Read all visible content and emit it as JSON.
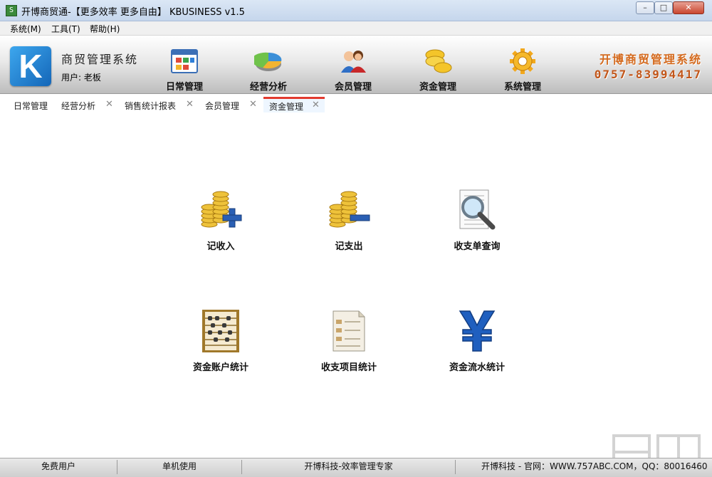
{
  "window": {
    "title": "开博商贸通-【更多效率 更多自由】 KBUSINESS v1.5",
    "app_icon_glyph": "S",
    "minimize": "–",
    "maximize": "□",
    "close": "✕"
  },
  "menu": [
    {
      "label": "系统(M)"
    },
    {
      "label": "工具(T)"
    },
    {
      "label": "帮助(H)"
    }
  ],
  "header": {
    "logo_letter": "K",
    "system_name": "商贸管理系统",
    "user_label": "用户: 老板",
    "nav": [
      {
        "label": "日常管理",
        "icon": "calendar-window-icon"
      },
      {
        "label": "经营分析",
        "icon": "pie-chart-icon"
      },
      {
        "label": "会员管理",
        "icon": "users-icon"
      },
      {
        "label": "资金管理",
        "icon": "coins-icon"
      },
      {
        "label": "系统管理",
        "icon": "gear-icon"
      }
    ],
    "brand_name": "开博商贸管理系统",
    "brand_phone": "0757-83994417"
  },
  "tabs": [
    {
      "label": "日常管理",
      "closable": false,
      "active": false
    },
    {
      "label": "经营分析",
      "closable": true,
      "active": false
    },
    {
      "label": "销售统计报表",
      "closable": true,
      "active": false
    },
    {
      "label": "会员管理",
      "closable": true,
      "active": false
    },
    {
      "label": "资金管理",
      "closable": true,
      "active": true
    }
  ],
  "tab_close_glyph": "✕",
  "functions": [
    {
      "label": "记收入",
      "icon": "coins-plus-icon"
    },
    {
      "label": "记支出",
      "icon": "coins-minus-icon"
    },
    {
      "label": "收支单查询",
      "icon": "magnifier-document-icon"
    },
    {
      "label": "资金账户统计",
      "icon": "abacus-icon"
    },
    {
      "label": "收支项目统计",
      "icon": "document-list-icon"
    },
    {
      "label": "资金流水统计",
      "icon": "yen-icon"
    }
  ],
  "status": [
    {
      "text": "免费用户"
    },
    {
      "text": "单机使用"
    },
    {
      "text": "开博科技-效率管理专家"
    },
    {
      "text": "开博科技 - 官网：WWW.757ABC.COM，QQ：80016460"
    }
  ],
  "colors": {
    "accent_tab": "#e23a2e",
    "brand_orange": "#d46a1e",
    "logo_blue": "#1a7fd4"
  }
}
